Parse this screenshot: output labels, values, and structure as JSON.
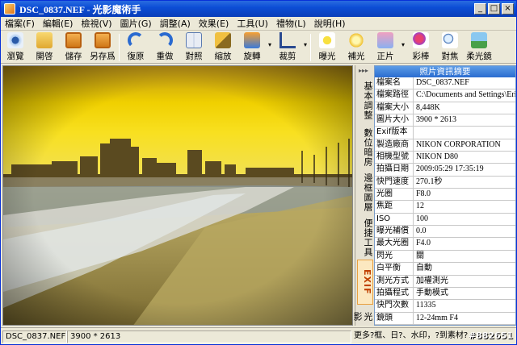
{
  "window": {
    "title": "DSC_0837.NEF - 光影魔術手",
    "min": "_",
    "max": "□",
    "close": "×"
  },
  "menu": [
    "檔案(F)",
    "編輯(E)",
    "檢視(V)",
    "圖片(G)",
    "調整(A)",
    "效果(E)",
    "工具(U)",
    "禮物(L)",
    "說明(H)"
  ],
  "toolbar": {
    "browse": "瀏覽",
    "open": "開啓",
    "save": "儲存",
    "saveas": "另存爲",
    "undo": "復原",
    "redo": "重做",
    "compare": "對照",
    "zoom": "縮放",
    "rotate": "旋轉",
    "crop": "裁剪",
    "exposure": "曝光",
    "fill": "補光",
    "film": "正片",
    "pencil": "彩棒",
    "focus": "對焦",
    "soft": "柔光鏡",
    "arrow": "▾"
  },
  "tabs": [
    "基本調整",
    "數位暗房",
    "邊框圖層",
    "便捷工具",
    "EXIF",
    "光影"
  ],
  "panel": {
    "header": "照片資訊摘要",
    "rows": [
      [
        "檔案名",
        "DSC_0837.NEF"
      ],
      [
        "檔案路徑",
        "C:\\Documents and Settings\\Eric\\"
      ],
      [
        "檔案大小",
        "8,448K"
      ],
      [
        "圖片大小",
        "3900 * 2613"
      ],
      [
        "Exif版本",
        ""
      ],
      [
        "製造廠商",
        "NIKON CORPORATION"
      ],
      [
        "相機型號",
        "NIKON D80"
      ],
      [
        "拍攝日期",
        "2009:05:29 17:35:19"
      ],
      [
        "快門速度",
        "270.1秒"
      ],
      [
        "光圈",
        "F8.0"
      ],
      [
        "焦距",
        "12"
      ],
      [
        "ISO",
        "100"
      ],
      [
        "曝光補償",
        "0.0"
      ],
      [
        "最大光圈",
        "F4.0"
      ],
      [
        "閃光",
        "關"
      ],
      [
        "白平衡",
        "自動"
      ],
      [
        "測光方式",
        "加權測光"
      ],
      [
        "拍攝程式",
        "手動模式"
      ],
      [
        "快門次數",
        "11335"
      ],
      [
        "鏡頭",
        "12-24mm F4"
      ]
    ]
  },
  "status": {
    "file": "DSC_0837.NEF",
    "size": "3900 * 2613",
    "tip": "更多?框、日?、水印，?到素材?",
    "watermark": "#882651"
  }
}
